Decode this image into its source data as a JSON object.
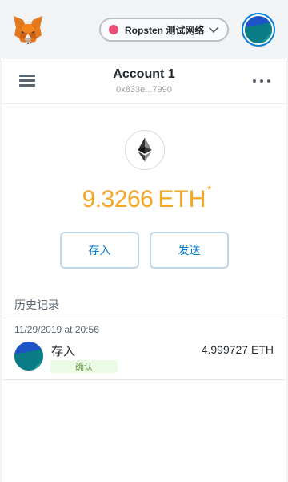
{
  "header": {
    "network": {
      "label": "Ropsten 测试网络",
      "dot_color": "#e94f77"
    }
  },
  "account": {
    "name": "Account 1",
    "address": "0x833e...7990"
  },
  "balance": {
    "amount": "9.3266",
    "unit": "ETH",
    "marker": "*"
  },
  "actions": {
    "deposit_label": "存入",
    "send_label": "发送"
  },
  "history": {
    "title": "历史记录",
    "transactions": [
      {
        "date": "11/29/2019 at 20:56",
        "type": "存入",
        "status": "确认",
        "amount": "4.999727 ETH"
      }
    ]
  },
  "colors": {
    "accent": "#037dd6",
    "balance": "#f6a623",
    "status_bg": "#ecfbe6",
    "status_text": "#6a9b4a"
  },
  "icons": [
    "metamask-fox-icon",
    "network-dot-icon",
    "chevron-down-icon",
    "account-avatar-icon",
    "hamburger-menu-icon",
    "more-options-icon",
    "ethereum-icon"
  ]
}
